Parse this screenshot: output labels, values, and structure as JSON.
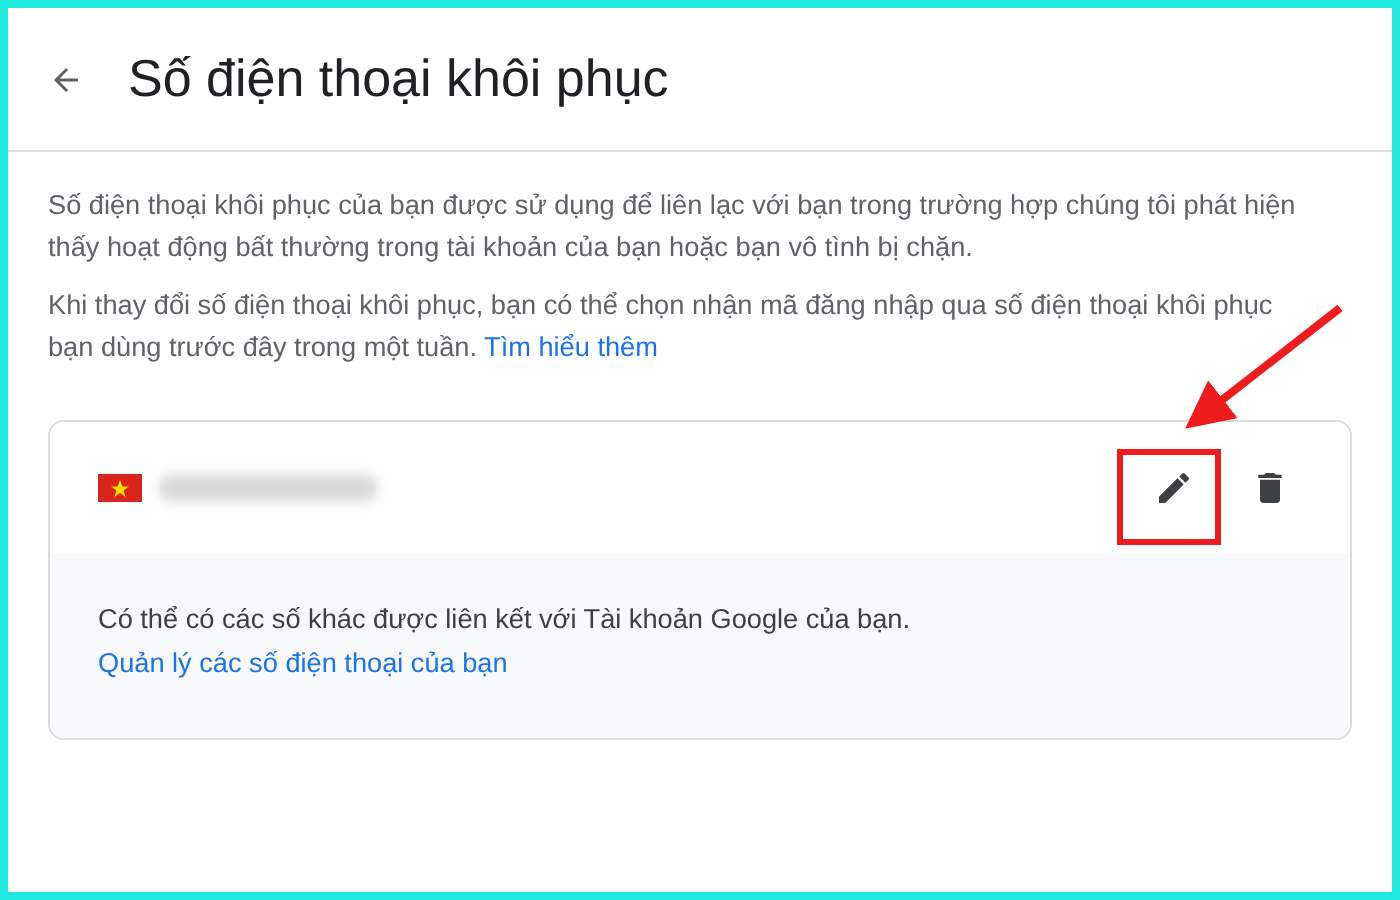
{
  "header": {
    "title": "Số điện thoại khôi phục"
  },
  "intro": [
    {
      "text": "Số điện thoại khôi phục của bạn được sử dụng để liên lạc với bạn trong trường hợp chúng tôi phát hiện thấy hoạt động bất thường trong tài khoản của bạn hoặc bạn vô tình bị chặn."
    },
    {
      "text": "Khi thay đổi số điện thoại khôi phục, bạn có thể chọn nhận mã đăng nhập qua số điện thoại khôi phục bạn dùng trước đây trong một tuần.",
      "link": "Tìm hiểu thêm"
    }
  ],
  "phone_card": {
    "footer": {
      "text": "Có thể có các số khác được liên kết với Tài khoản Google của bạn.",
      "link": "Quản lý các số điện thoại của bạn"
    }
  }
}
